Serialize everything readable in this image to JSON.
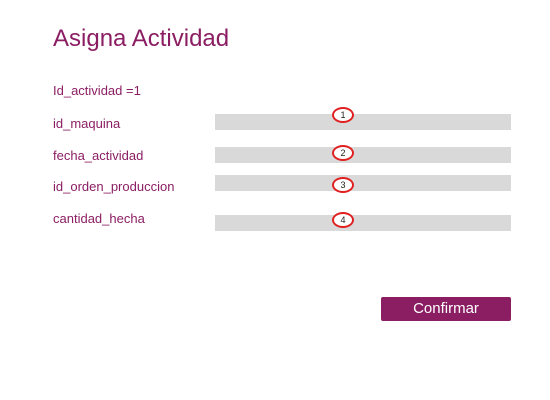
{
  "title": "Asigna Actividad",
  "id_line": "Id_actividad =1",
  "fields": [
    {
      "label": "id_maquina",
      "value": "",
      "badge": "1"
    },
    {
      "label": "fecha_actividad",
      "value": "",
      "badge": "2"
    },
    {
      "label": "id_orden_produccion",
      "value": "",
      "badge": "3"
    },
    {
      "label": "cantidad_hecha",
      "value": "",
      "badge": "4"
    }
  ],
  "confirm_label": "Confirmar",
  "colors": {
    "accent": "#8b1e63",
    "input_bg": "#d9d9d9",
    "badge_border": "#e02020"
  }
}
